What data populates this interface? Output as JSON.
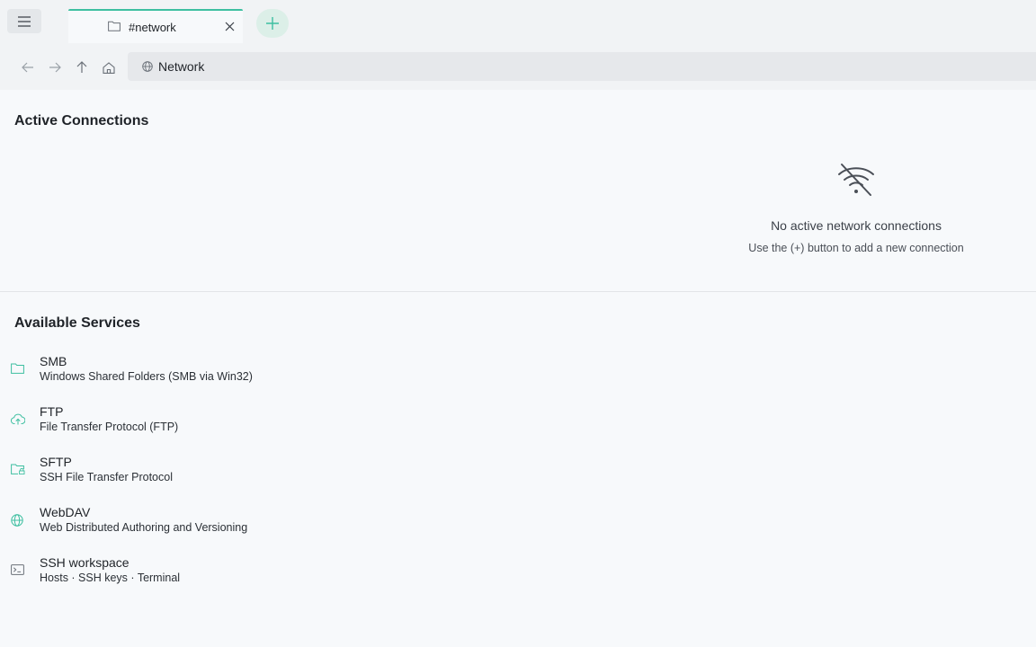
{
  "tab": {
    "label": "#network"
  },
  "address": {
    "text": "Network"
  },
  "active": {
    "title": "Active Connections",
    "empty_title": "No active network connections",
    "empty_sub": "Use the (+) button to add a new connection"
  },
  "services": {
    "title": "Available Services",
    "items": [
      {
        "name": "SMB",
        "desc": "Windows Shared Folders (SMB via Win32)",
        "icon": "folder-icon"
      },
      {
        "name": "FTP",
        "desc": "File Transfer Protocol (FTP)",
        "icon": "cloud-upload-icon"
      },
      {
        "name": "SFTP",
        "desc": "SSH File Transfer Protocol",
        "icon": "folder-lock-icon"
      },
      {
        "name": "WebDAV",
        "desc": "Web Distributed Authoring and Versioning",
        "icon": "globe-icon"
      },
      {
        "name": "SSH workspace",
        "desc": "Hosts · SSH keys · Terminal",
        "icon": "terminal-icon"
      }
    ]
  },
  "colors": {
    "accent": "#3dbfa0"
  }
}
